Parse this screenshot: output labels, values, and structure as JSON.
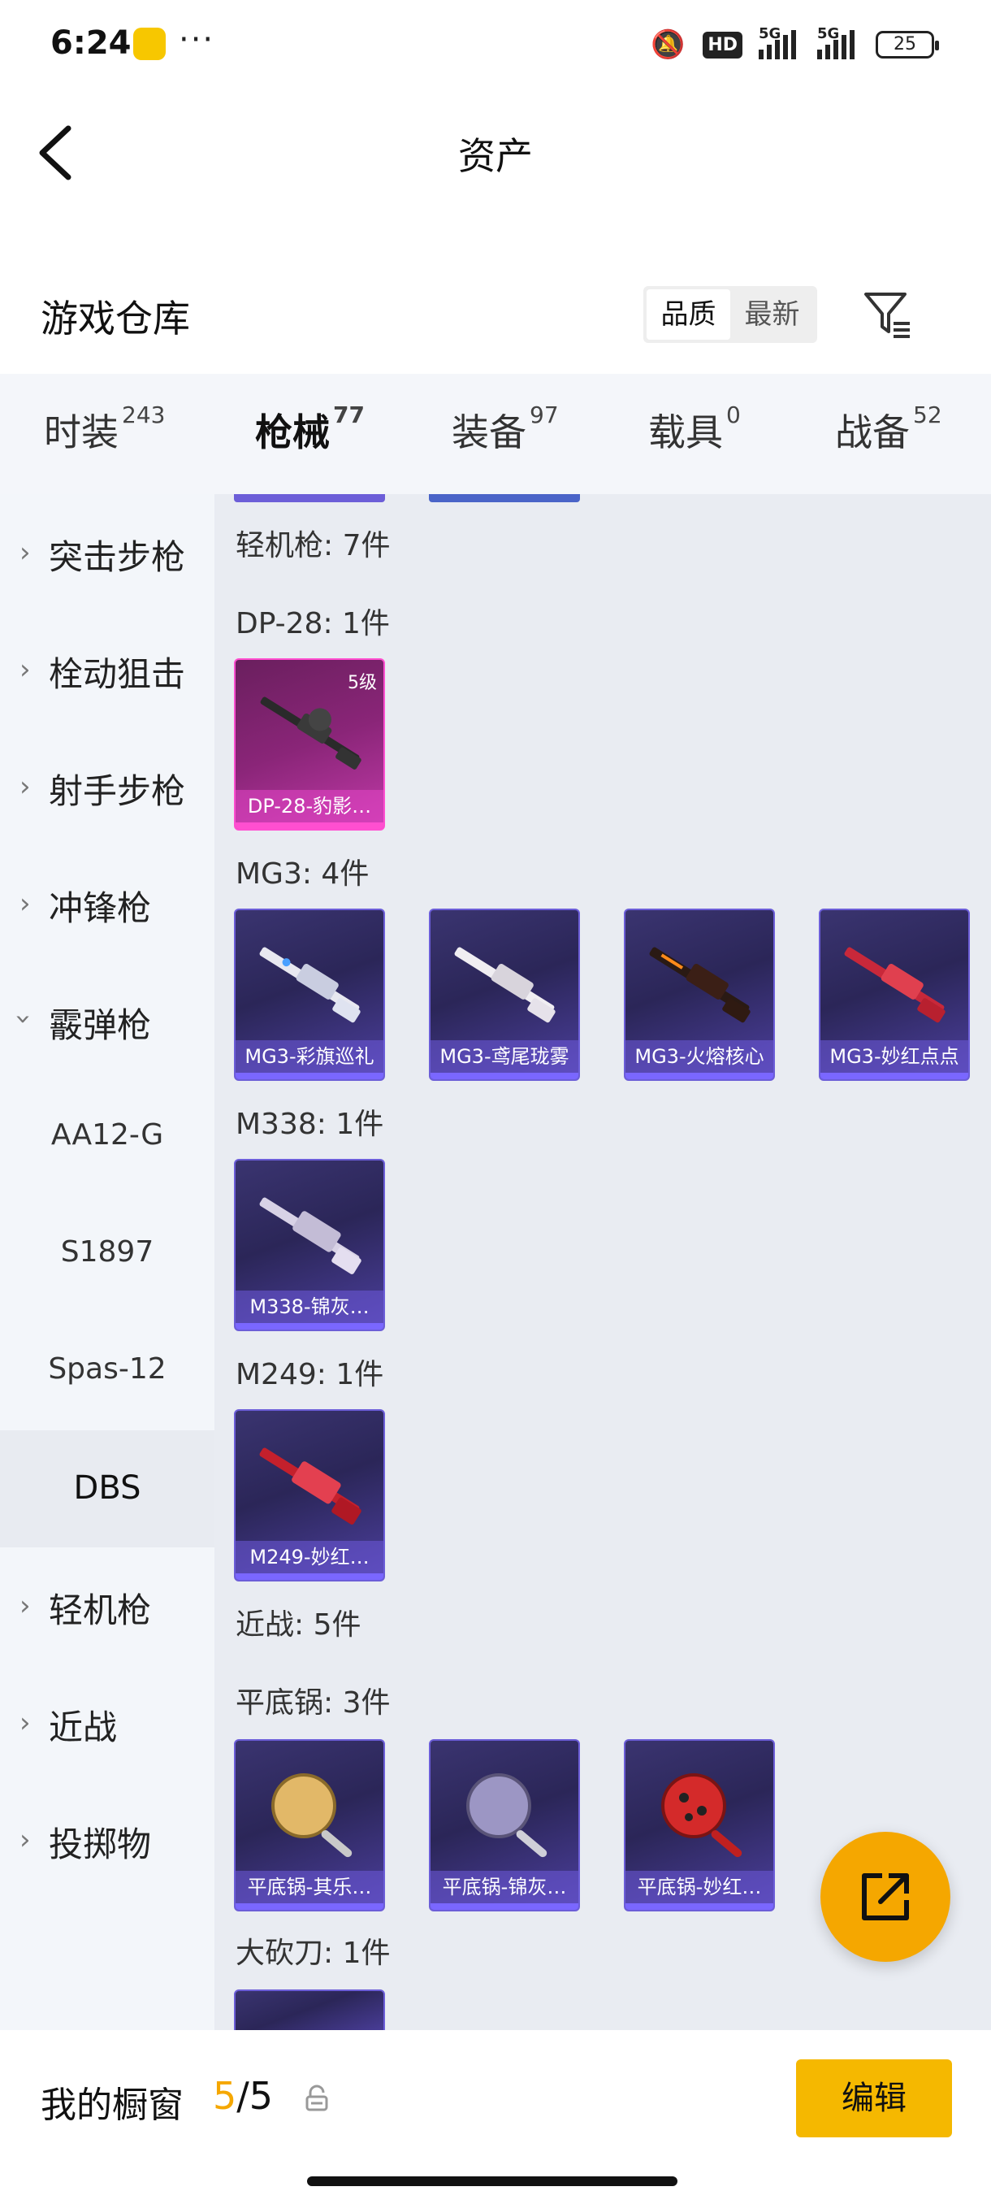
{
  "status_bar": {
    "time": "6:24",
    "hd": "HD",
    "net1": "5G",
    "net2": "5G",
    "battery": "25",
    "more": "···"
  },
  "nav": {
    "title": "资产"
  },
  "warehouse": {
    "title": "游戏仓库",
    "sort_options": [
      "品质",
      "最新"
    ],
    "active_sort": "品质"
  },
  "tabs": [
    {
      "label": "时装",
      "count": "243"
    },
    {
      "label": "枪械",
      "count": "77"
    },
    {
      "label": "装备",
      "count": "97"
    },
    {
      "label": "载具",
      "count": "0"
    },
    {
      "label": "战备",
      "count": "52"
    }
  ],
  "sidebar": {
    "items": [
      {
        "label": "突击步枪",
        "icon": "chevron-right-icon"
      },
      {
        "label": "栓动狙击",
        "icon": "chevron-right-icon"
      },
      {
        "label": "射手步枪",
        "icon": "chevron-right-icon"
      },
      {
        "label": "冲锋枪",
        "icon": "chevron-right-icon"
      },
      {
        "label": "霰弹枪",
        "icon": "chevron-down-icon"
      },
      {
        "label": "AA12-G"
      },
      {
        "label": "S1897"
      },
      {
        "label": "Spas-12"
      },
      {
        "label": "DBS",
        "selected": true
      },
      {
        "label": "轻机枪",
        "icon": "chevron-right-icon"
      },
      {
        "label": "近战",
        "icon": "chevron-right-icon"
      },
      {
        "label": "投掷物",
        "icon": "chevron-right-icon"
      }
    ]
  },
  "main": {
    "category_lmg": "轻机枪: 7件",
    "groups": [
      {
        "label": "DP-28: 1件",
        "cards": [
          {
            "name": "DP-28-豹影…",
            "level": "5级",
            "rarity": "pink"
          }
        ]
      },
      {
        "label": "MG3: 4件",
        "cards": [
          {
            "name": "MG3-彩旗巡礼"
          },
          {
            "name": "MG3-鸢尾珑雾"
          },
          {
            "name": "MG3-火熔核心"
          },
          {
            "name": "MG3-妙红点点"
          }
        ]
      },
      {
        "label": "M338: 1件",
        "cards": [
          {
            "name": "M338-锦灰…"
          }
        ]
      },
      {
        "label": "M249: 1件",
        "cards": [
          {
            "name": "M249-妙红…"
          }
        ]
      }
    ],
    "category_melee": "近战: 5件",
    "pan_group": {
      "label": "平底锅: 3件",
      "cards": [
        {
          "name": "平底锅-其乐…"
        },
        {
          "name": "平底锅-锦灰…"
        },
        {
          "name": "平底锅-妙红…"
        }
      ]
    },
    "machete_label": "大砍刀: 1件"
  },
  "bottom": {
    "title": "我的橱窗",
    "count_current": "5",
    "count_total": "/5",
    "edit_label": "编辑"
  },
  "colors": {
    "accent": "#f5b800",
    "epic_border": "#6c5ed8",
    "legend_border": "#ff4fd0"
  }
}
